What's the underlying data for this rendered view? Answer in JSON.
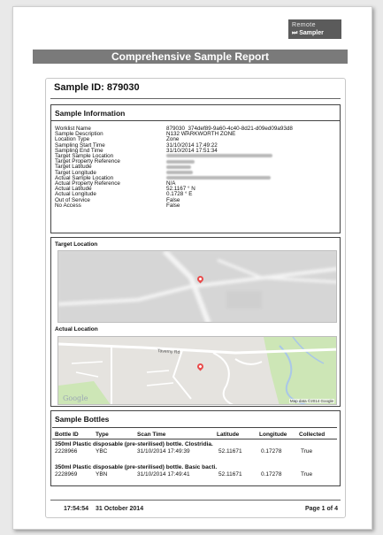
{
  "logo": {
    "line1": "Remote",
    "line2": "Sampler"
  },
  "report_title": "Comprehensive Sample Report",
  "sample_id": "Sample ID: 879030",
  "sample_information": {
    "heading": "Sample Information",
    "rows": [
      {
        "label": "Worklist Name",
        "value": "879030_374def89-9a60-4c40-8d21-d09ed09a93d8"
      },
      {
        "label": "Sample Description",
        "value": "N132 WARKWORTH ZONE"
      },
      {
        "label": "Location Type",
        "value": "Zone"
      },
      {
        "label": "Sampling Start Time",
        "value": "31/10/2014 17:49:22"
      },
      {
        "label": "Sampling End Time",
        "value": "31/10/2014 17:51:34"
      },
      {
        "label": "Target Sample Location",
        "value": ""
      },
      {
        "label": "Target Property Reference",
        "value": ""
      },
      {
        "label": "Target Latitude",
        "value": ""
      },
      {
        "label": "Target Longitude",
        "value": ""
      },
      {
        "label": "Actual Sample Location",
        "value": ""
      },
      {
        "label": "Actual Property Reference",
        "value": "N/A"
      },
      {
        "label": "Actual Latitude",
        "value": "52.1167 ° N"
      },
      {
        "label": "Actual Longitude",
        "value": "0.1728 ° E"
      },
      {
        "label": "Out of Service",
        "value": "False"
      },
      {
        "label": "No Access",
        "value": "False"
      }
    ]
  },
  "target_location_label": "Target Location",
  "actual_location_label": "Actual Location",
  "actual_map": {
    "street_label": "Taverny Rd",
    "credit": "Map data ©2014 Google",
    "google": "Google"
  },
  "sample_bottles": {
    "heading": "Sample Bottles",
    "columns": [
      "Bottle ID",
      "Type",
      "Scan Time",
      "Latitude",
      "Longitude",
      "Collected"
    ],
    "groups": [
      {
        "title": "350ml Plastic disposable (pre-sterilised) bottle. Clostridia.",
        "row": [
          "2228966",
          "YBC",
          "31/10/2014 17:49:39",
          "52.11671",
          "0.17278",
          "True"
        ]
      },
      {
        "title": "350ml Plastic disposable (pre-sterilised) bottle. Basic bacti.",
        "row": [
          "2228969",
          "YBN",
          "31/10/2014 17:49:41",
          "52.11671",
          "0.17278",
          "True"
        ]
      }
    ]
  },
  "footer": {
    "time": "17:54:54",
    "date": "31 October 2014",
    "page": "Page 1 of 4"
  },
  "colors": {
    "title_bar": "#7a7a7a",
    "pin": "#e94b4b",
    "map_bg": "#e5e3df",
    "park": "#cde6b6",
    "water": "#a9c7e8"
  }
}
